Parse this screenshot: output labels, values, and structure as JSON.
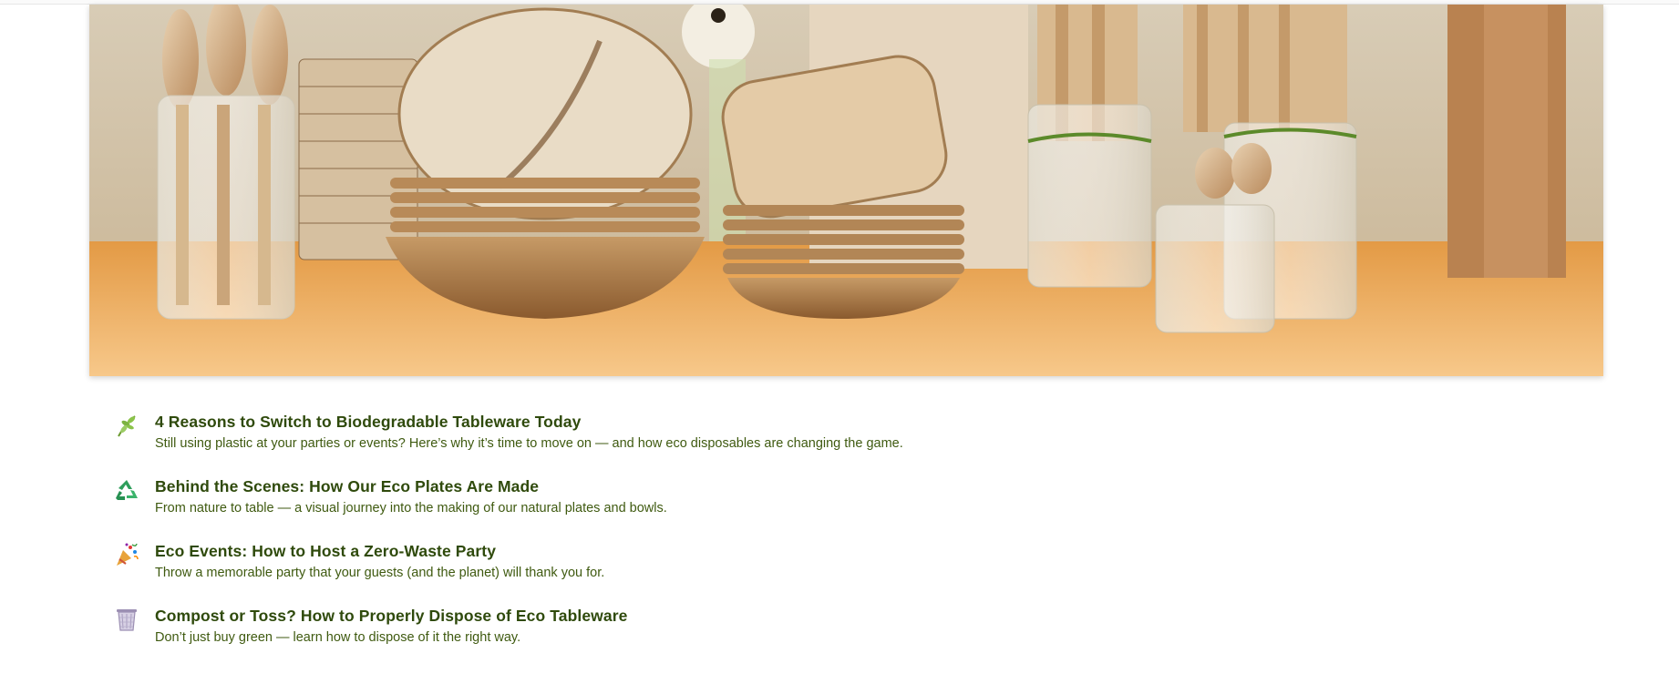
{
  "hero": {
    "image_description_icon": "tableware-photo"
  },
  "posts": [
    {
      "icon": "herb-icon",
      "title": "4 Reasons to Switch to Biodegradable Tableware Today",
      "description": "Still using plastic at your parties or events? Here’s why it’s time to move on — and how eco disposables are changing the game."
    },
    {
      "icon": "recycle-icon",
      "title": "Behind the Scenes: How Our Eco Plates Are Made",
      "description": "From nature to table — a visual journey into the making of our natural plates and bowls."
    },
    {
      "icon": "party-popper-icon",
      "title": "Eco Events: How to Host a Zero-Waste Party",
      "description": "Throw a memorable party that your guests (and the planet) will thank you for."
    },
    {
      "icon": "wastebasket-icon",
      "title": "Compost or Toss? How to Properly Dispose of Eco Tableware",
      "description": "Don’t just buy green — learn how to dispose of it the right way."
    }
  ],
  "colors": {
    "title": "#2f4a0c",
    "description": "#3f5a10",
    "accent_green": "#7cb342"
  }
}
